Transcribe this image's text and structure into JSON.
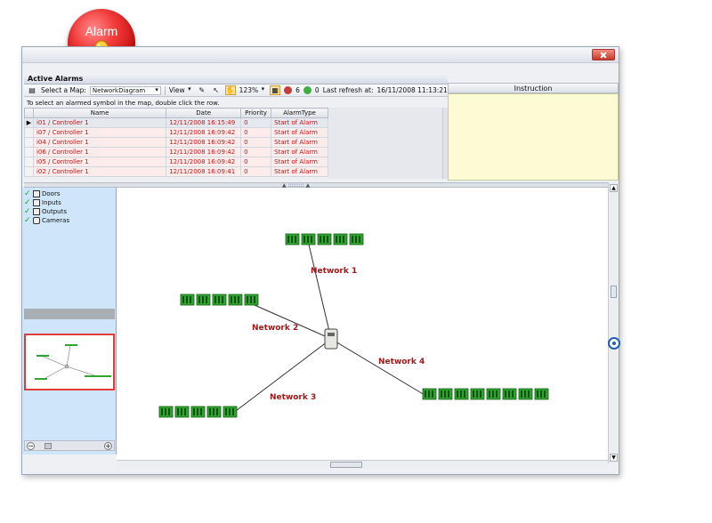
{
  "badge": {
    "label": "Alarm"
  },
  "pane": {
    "title": "Active Alarms",
    "toolbar": {
      "select_map_label": "Select a Map:",
      "map_value": "NetworkDiagram",
      "view_label": "View",
      "zoom": "123%",
      "alarm_count": "6",
      "ok_count": "0",
      "last_refresh_label": "Last refresh at:",
      "last_refresh_value": "16/11/2008 11:13:21"
    },
    "hint": "To select an alarmed symbol in the map, double click the row."
  },
  "table": {
    "headers": [
      "Name",
      "Date",
      "Priority",
      "AlarmType"
    ],
    "rows": [
      [
        "i01 / Controller 1",
        "12/11/2008 16:15:49",
        "0",
        "Start of Alarm"
      ],
      [
        "i07 / Controller 1",
        "12/11/2008 16:09:42",
        "0",
        "Start of Alarm"
      ],
      [
        "i04 / Controller 1",
        "12/11/2008 16:09:42",
        "0",
        "Start of Alarm"
      ],
      [
        "i06 / Controller 1",
        "12/11/2008 16:09:42",
        "0",
        "Start of Alarm"
      ],
      [
        "i05 / Controller 1",
        "12/11/2008 16:09:42",
        "0",
        "Start of Alarm"
      ],
      [
        "i02 / Controller 1",
        "12/11/2008 16:09:41",
        "0",
        "Start of Alarm"
      ]
    ]
  },
  "instruction": {
    "title": "Instruction"
  },
  "legend": [
    {
      "label": "Doors",
      "icon": "door-icon"
    },
    {
      "label": "Inputs",
      "icon": "input-icon"
    },
    {
      "label": "Outputs",
      "icon": "output-icon"
    },
    {
      "label": "Cameras",
      "icon": "camera-icon"
    }
  ],
  "map": {
    "networks": [
      {
        "label": "Network 1",
        "devices": 5
      },
      {
        "label": "Network 2",
        "devices": 5
      },
      {
        "label": "Network 3",
        "devices": 5
      },
      {
        "label": "Network 4",
        "devices": 8
      }
    ]
  },
  "colors": {
    "alarm_text": "#c01818",
    "device_green": "#2fa52f",
    "network_label": "#a01818",
    "instruction_bg": "#fcfbd4",
    "side_panel_bg": "#cfe6fa"
  }
}
